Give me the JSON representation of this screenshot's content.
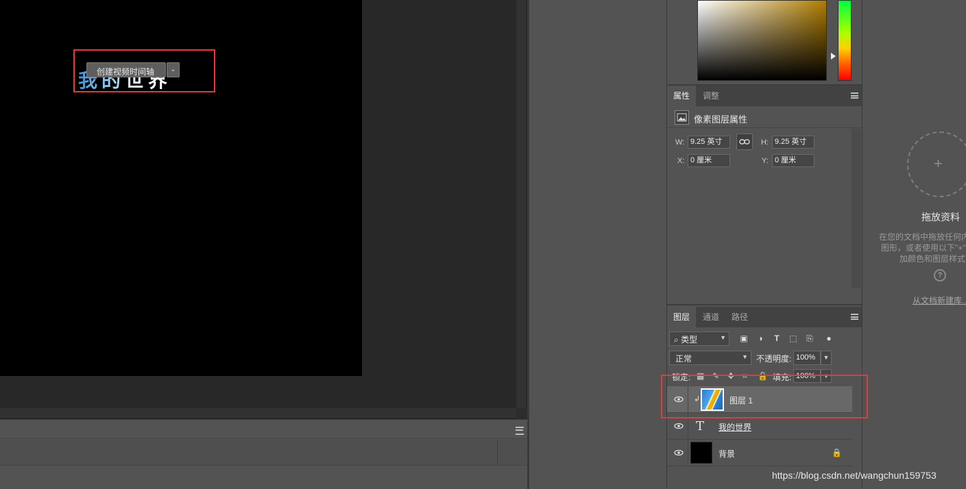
{
  "canvas": {
    "text": "我的世界"
  },
  "timeline": {
    "create_button": "创建视频时间轴",
    "dropdown_arrow": "⌄"
  },
  "properties": {
    "tabs": [
      "属性",
      "调整"
    ],
    "title": "像素图层属性",
    "w_label": "W:",
    "w_value": "9.25 英寸",
    "h_label": "H:",
    "h_value": "9.25 英寸",
    "x_label": "X:",
    "x_value": "0 厘米",
    "y_label": "Y:",
    "y_value": "0 厘米"
  },
  "layers_panel": {
    "tabs": [
      "图层",
      "通道",
      "路径"
    ],
    "filter": "类型",
    "blend_mode": "正常",
    "opacity_label": "不透明度:",
    "opacity_value": "100%",
    "lock_label": "锁定:",
    "fill_label": "填充:",
    "fill_value": "100%",
    "layers": [
      {
        "name": "图层 1"
      },
      {
        "name": "我的世界"
      },
      {
        "name": "背景"
      }
    ]
  },
  "libraries": {
    "title": "拖放资料",
    "desc_line1": "在您的文档中拖放任何内",
    "desc_line2": "图形，或者使用以下\"+\"",
    "desc_line3": "加颜色和图层样式",
    "help": "?",
    "link": "从文档新建库..."
  },
  "watermark": "https://blog.csdn.net/wangchun159753",
  "colors": {
    "highlight": "#e8383c",
    "panel_bg": "#535353",
    "canvas_bg": "#000000"
  }
}
